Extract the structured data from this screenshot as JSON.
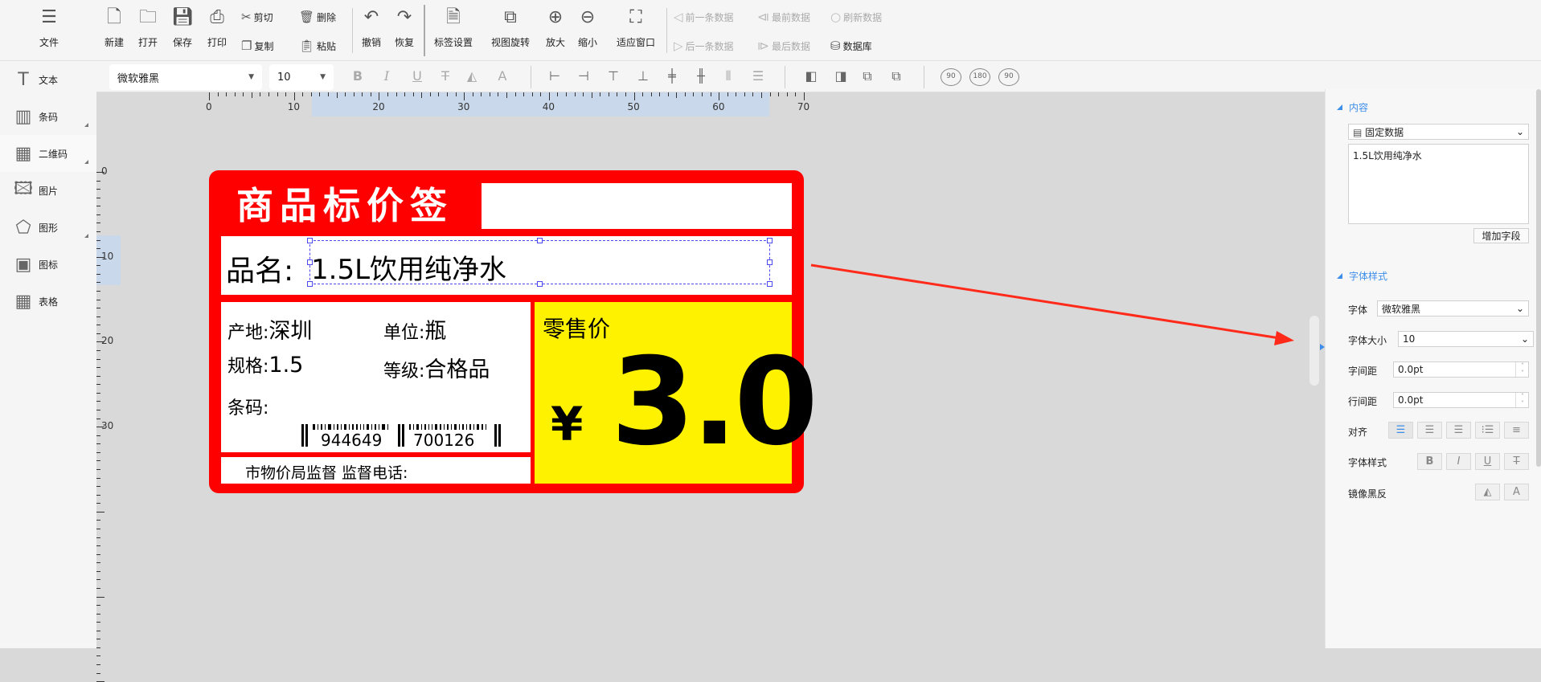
{
  "toolbar": {
    "file": "文件",
    "new": "新建",
    "open": "打开",
    "save": "保存",
    "print": "打印",
    "cut": "剪切",
    "copy": "复制",
    "delete": "删除",
    "paste": "粘贴",
    "undo": "撤销",
    "redo": "恢复",
    "label_settings": "标签设置",
    "rotate_view": "视图旋转",
    "zoom_in": "放大",
    "zoom_out": "缩小",
    "fit_window": "适应窗口",
    "prev_record": "前一条数据",
    "first_record": "最前数据",
    "refresh_data": "刷新数据",
    "next_record": "后一条数据",
    "last_record": "最后数据",
    "database": "数据库"
  },
  "format_bar": {
    "font": "微软雅黑",
    "size": "10",
    "rotate": [
      "90",
      "180",
      "90"
    ]
  },
  "sidebar": {
    "items": [
      {
        "label": "文本",
        "icon": "text-icon"
      },
      {
        "label": "条码",
        "icon": "barcode-icon"
      },
      {
        "label": "二维码",
        "icon": "qrcode-icon"
      },
      {
        "label": "图片",
        "icon": "image-icon"
      },
      {
        "label": "图形",
        "icon": "shape-icon"
      },
      {
        "label": "图标",
        "icon": "logo-icon"
      },
      {
        "label": "表格",
        "icon": "table-icon"
      }
    ]
  },
  "ruler": {
    "h": [
      "0",
      "10",
      "20",
      "30",
      "40",
      "50",
      "60",
      "70"
    ],
    "v": [
      "0",
      "10",
      "20",
      "30"
    ]
  },
  "label": {
    "title": "商品标价签",
    "name_key": "品名:",
    "name_value": "1.5L饮用纯净水",
    "origin_key": "产地:",
    "origin_value": "深圳",
    "unit_key": "单位:",
    "unit_value": "瓶",
    "spec_key": "规格:",
    "spec_value": "1.5",
    "grade_key": "等级:",
    "grade_value": "合格品",
    "barcode_key": "条码:",
    "barcode_left": "944649",
    "barcode_right": "700126",
    "footer": "市物价局监督  监督电话:",
    "price_title": "零售价",
    "currency": "¥",
    "price": "3.0",
    "colors": {
      "frame": "#ff0000",
      "price_bg": "#fff200"
    }
  },
  "panel": {
    "content_header": "内容",
    "source": "固定数据",
    "content_value": "1.5L饮用纯净水",
    "add_field": "增加字段",
    "font_header": "字体样式",
    "font_label": "字体",
    "font_value": "微软雅黑",
    "size_label": "字体大小",
    "size_value": "10",
    "letter_label": "字间距",
    "letter_value": "0.0pt",
    "line_label": "行间距",
    "line_value": "0.0pt",
    "align_label": "对齐",
    "style_label": "字体样式",
    "mirror_label": "镜像黑反",
    "accent": "#3d8ee8"
  }
}
